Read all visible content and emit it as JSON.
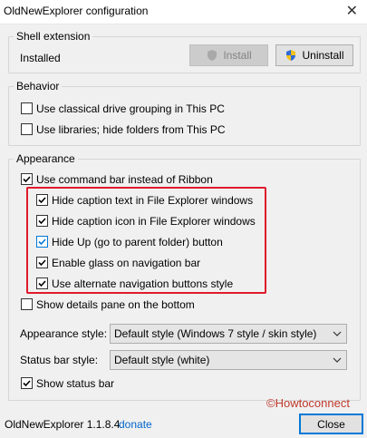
{
  "window": {
    "title": "OldNewExplorer configuration",
    "close_glyph": "✕"
  },
  "shell_extension": {
    "legend": "Shell extension",
    "status": "Installed",
    "install_label": "Install",
    "uninstall_label": "Uninstall"
  },
  "behavior": {
    "legend": "Behavior",
    "options": [
      {
        "label": "Use classical drive grouping in This PC",
        "checked": false
      },
      {
        "label": "Use libraries; hide folders from This PC",
        "checked": false
      }
    ]
  },
  "appearance": {
    "legend": "Appearance",
    "command_bar": {
      "label": "Use command bar instead of Ribbon",
      "checked": true
    },
    "sub_options": [
      {
        "label": "Hide caption text in File Explorer windows",
        "checked": true
      },
      {
        "label": "Hide caption icon in File Explorer windows",
        "checked": true
      },
      {
        "label": "Hide Up (go to parent folder) button",
        "checked": true
      },
      {
        "label": "Enable glass on navigation bar",
        "checked": true
      },
      {
        "label": "Use alternate navigation buttons style",
        "checked": true
      }
    ],
    "details_pane": {
      "label": "Show details pane on the bottom",
      "checked": false
    },
    "appearance_style": {
      "label": "Appearance style:",
      "value": "Default style (Windows 7 style / skin style)"
    },
    "status_bar_style": {
      "label": "Status bar style:",
      "value": "Default style (white)"
    },
    "show_status_bar": {
      "label": "Show status bar",
      "checked": true
    }
  },
  "footer": {
    "version": "OldNewExplorer 1.1.8.4",
    "donate": "donate",
    "close_label": "Close",
    "watermark": "©Howtoconnect"
  },
  "colors": {
    "highlight": "#e01a2b",
    "link": "#0066cc",
    "focus": "#0078d7"
  }
}
